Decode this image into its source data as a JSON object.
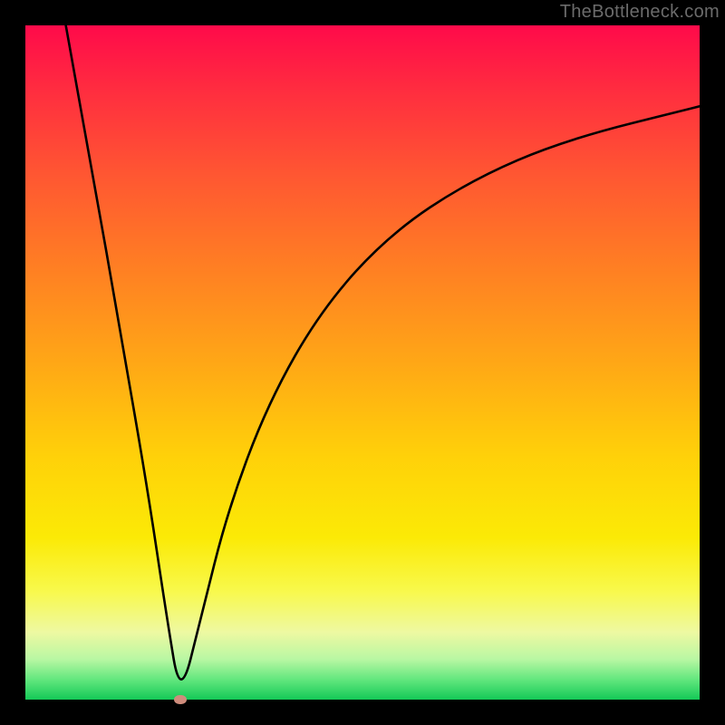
{
  "watermark": "TheBottleneck.com",
  "chart_data": {
    "type": "line",
    "title": "",
    "xlabel": "",
    "ylabel": "",
    "xlim": [
      0,
      100
    ],
    "ylim": [
      0,
      100
    ],
    "background_gradient": [
      "#ff0a4a",
      "#ff5632",
      "#ffa716",
      "#fbea06",
      "#63e77e",
      "#14c957"
    ],
    "min_marker": {
      "x": 23,
      "y": 0,
      "color": "#cf8c7c"
    },
    "series": [
      {
        "name": "left-branch",
        "x": [
          6,
          10,
          14,
          18,
          21,
          23
        ],
        "y": [
          100,
          78,
          55,
          32,
          12,
          0
        ]
      },
      {
        "name": "right-branch",
        "x": [
          23,
          26,
          30,
          36,
          44,
          54,
          66,
          80,
          100
        ],
        "y": [
          0,
          12,
          28,
          44,
          58,
          69,
          77,
          83,
          88
        ]
      }
    ]
  }
}
